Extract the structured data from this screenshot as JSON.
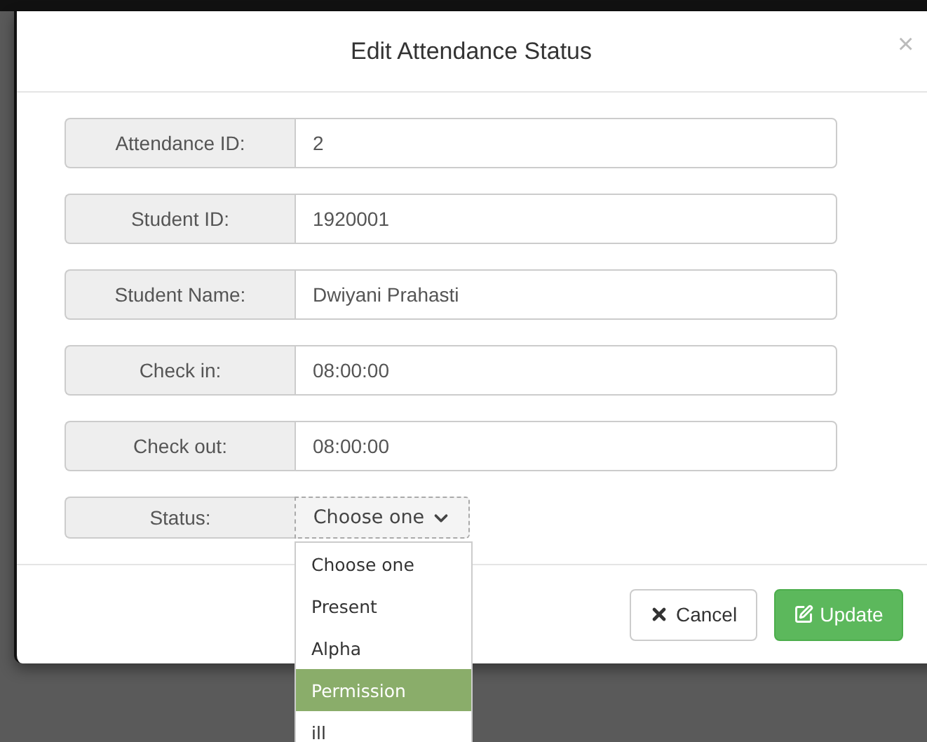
{
  "modal": {
    "title": "Edit Attendance Status",
    "close": "×"
  },
  "fields": [
    {
      "label": "Attendance ID:",
      "value": "2"
    },
    {
      "label": "Student ID:",
      "value": "1920001"
    },
    {
      "label": "Student Name:",
      "value": "Dwiyani Prahasti"
    },
    {
      "label": "Check in:",
      "value": "08:00:00"
    },
    {
      "label": "Check out:",
      "value": "08:00:00"
    }
  ],
  "status": {
    "label": "Status:",
    "value": "Choose one",
    "options": [
      {
        "label": "Choose one",
        "highlighted": false
      },
      {
        "label": "Present",
        "highlighted": false
      },
      {
        "label": "Alpha",
        "highlighted": false
      },
      {
        "label": "Permission",
        "highlighted": true
      },
      {
        "label": "ill",
        "highlighted": false
      }
    ]
  },
  "buttons": [
    {
      "label": "Cancel",
      "kind": "cancel"
    },
    {
      "label": "Update",
      "kind": "update"
    }
  ]
}
